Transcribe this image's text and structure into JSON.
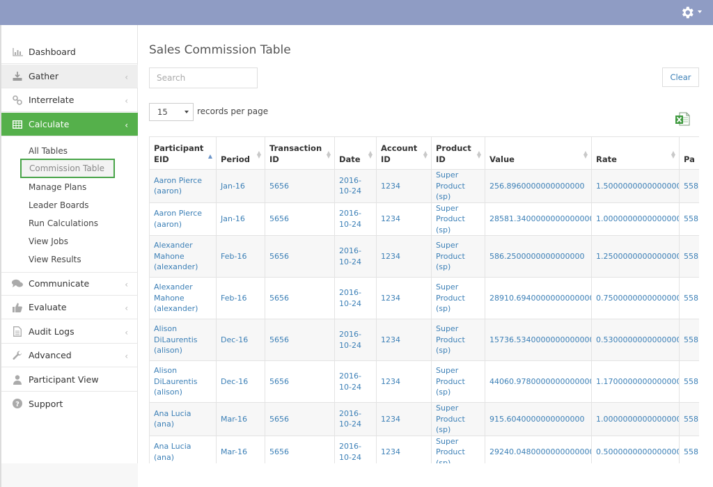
{
  "colors": {
    "topbar": "#8f9cc4",
    "active": "#55b04b",
    "link": "#3b7fb6",
    "highlight_border": "#47a447"
  },
  "sidebar": {
    "items": [
      {
        "label": "Dashboard",
        "icon": "bar-chart-icon"
      },
      {
        "label": "Gather",
        "icon": "download-icon"
      },
      {
        "label": "Interrelate",
        "icon": "link-icon"
      },
      {
        "label": "Calculate",
        "icon": "table-icon"
      },
      {
        "label": "Communicate",
        "icon": "comments-icon"
      },
      {
        "label": "Evaluate",
        "icon": "thumbs-up-icon"
      },
      {
        "label": "Audit Logs",
        "icon": "file-icon"
      },
      {
        "label": "Advanced",
        "icon": "wrench-icon"
      },
      {
        "label": "Participant View",
        "icon": "user-icon"
      },
      {
        "label": "Support",
        "icon": "question-icon"
      }
    ],
    "calculate_sub": [
      "All Tables",
      "Commission Table",
      "Manage Plans",
      "Leader Boards",
      "Run Calculations",
      "View Jobs",
      "View Results"
    ]
  },
  "main": {
    "title": "Sales Commission Table",
    "search_placeholder": "Search",
    "clear_label": "Clear",
    "page_size": "15",
    "records_per_page": "records per page"
  },
  "table": {
    "columns": [
      {
        "label": "Participant EID",
        "sorted": true
      },
      {
        "label": "Period"
      },
      {
        "label": "Transaction ID"
      },
      {
        "label": "Date"
      },
      {
        "label": "Account ID"
      },
      {
        "label": "Product ID"
      },
      {
        "label": "Value"
      },
      {
        "label": "Rate"
      },
      {
        "label": "Pa"
      }
    ],
    "rows": [
      {
        "participant": "Aaron Pierce (aaron)",
        "period": "Jan-16",
        "transaction": "5656",
        "date": "2016-10-24",
        "account": "1234",
        "product": "Super Product (sp)",
        "value": "256.8960000000000000",
        "rate": "1.5000000000000000",
        "pa": "558"
      },
      {
        "participant": "Aaron Pierce (aaron)",
        "period": "Jan-16",
        "transaction": "5656",
        "date": "2016-10-24",
        "account": "1234",
        "product": "Super Product (sp)",
        "value": "28581.3400000000000000",
        "rate": "1.0000000000000000",
        "pa": "558"
      },
      {
        "participant": "Alexander Mahone (alexander)",
        "period": "Feb-16",
        "transaction": "5656",
        "date": "2016-10-24",
        "account": "1234",
        "product": "Super Product (sp)",
        "value": "586.2500000000000000",
        "rate": "1.2500000000000000",
        "pa": "558"
      },
      {
        "participant": "Alexander Mahone (alexander)",
        "period": "Feb-16",
        "transaction": "5656",
        "date": "2016-10-24",
        "account": "1234",
        "product": "Super Product (sp)",
        "value": "28910.6940000000000000",
        "rate": "0.7500000000000000",
        "pa": "558"
      },
      {
        "participant": "Alison DiLaurentis (alison)",
        "period": "Dec-16",
        "transaction": "5656",
        "date": "2016-10-24",
        "account": "1234",
        "product": "Super Product (sp)",
        "value": "15736.5340000000000000",
        "rate": "0.5300000000000000",
        "pa": "558"
      },
      {
        "participant": "Alison DiLaurentis (alison)",
        "period": "Dec-16",
        "transaction": "5656",
        "date": "2016-10-24",
        "account": "1234",
        "product": "Super Product (sp)",
        "value": "44060.9780000000000000",
        "rate": "1.1700000000000000",
        "pa": "558"
      },
      {
        "participant": "Ana Lucia (ana)",
        "period": "Mar-16",
        "transaction": "5656",
        "date": "2016-10-24",
        "account": "1234",
        "product": "Super Product (sp)",
        "value": "915.6040000000000000",
        "rate": "1.0000000000000000",
        "pa": "558"
      },
      {
        "participant": "Ana Lucia (ana)",
        "period": "Mar-16",
        "transaction": "5656",
        "date": "2016-10-24",
        "account": "1234",
        "product": "Super Product (sp)",
        "value": "29240.0480000000000000",
        "rate": "0.5000000000000000",
        "pa": "558"
      }
    ]
  }
}
